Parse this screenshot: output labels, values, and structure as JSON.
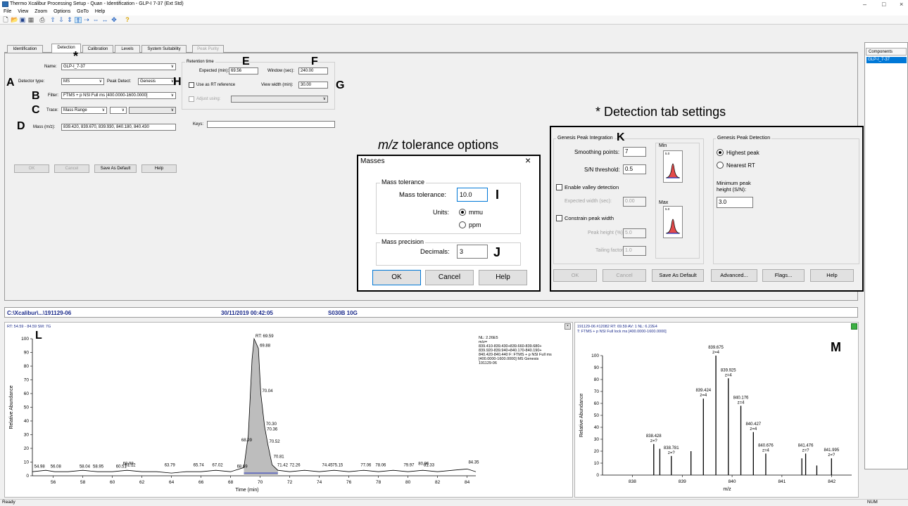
{
  "window": {
    "title": "Thermo Xcalibur Processing Setup - Quan - Identification - GLP-I 7-37 (Ext Std)",
    "controls": [
      "–",
      "□",
      "×"
    ]
  },
  "menu": [
    "File",
    "View",
    "Zoom",
    "Options",
    "GoTo",
    "Help"
  ],
  "tabs": [
    "Identification",
    "Detection",
    "Calibration",
    "Levels",
    "System Suitability",
    "Peak Purity"
  ],
  "identification": {
    "name_label": "Name:",
    "name_value": "GLP-I_7-37",
    "detector_type_label": "Detector type:",
    "detector_type_value": "MS",
    "peak_detect_label": "Peak Detect:",
    "peak_detect_value": "Genesis",
    "filter_label": "Filter:",
    "filter_value": "FTMS + p NSI Full ms [400.0000-1600.0000]",
    "trace_label": "Trace:",
    "trace_value": "Mass Range",
    "mass_label": "Mass (m/z):",
    "mass_value": "839.420, 839.670, 839.930, 840.180, 840.430",
    "retention_time_label": "Retention time",
    "expected_label": "Expected (min):",
    "expected_value": "69.56",
    "window_label": "Window (sec):",
    "window_value": "240.00",
    "use_rt_reference": "Use as RT reference",
    "view_width_label": "View width (min):",
    "view_width_value": "30.00",
    "adjust_using": "Adjust using:",
    "keys_label": "Keys:",
    "buttons": [
      "OK",
      "Cancel",
      "Save As Default",
      "Help"
    ]
  },
  "annotations": {
    "letters": [
      "A",
      "B",
      "C",
      "D",
      "E",
      "F",
      "G",
      "H",
      "I",
      "J",
      "K",
      "L",
      "M"
    ],
    "star": "*",
    "mz_tolerance_title_italic": "m/z",
    "mz_tolerance_title_rest": " tolerance options",
    "detection_title": "* Detection tab settings"
  },
  "masses_dialog": {
    "title": "Masses",
    "mass_tolerance_group": "Mass tolerance",
    "mass_tolerance_label": "Mass tolerance:",
    "mass_tolerance_value": "10.0",
    "units_label": "Units:",
    "unit_mmu": "mmu",
    "unit_ppm": "ppm",
    "mass_precision_group": "Mass precision",
    "decimals_label": "Decimals:",
    "decimals_value": "3",
    "ok": "OK",
    "cancel": "Cancel",
    "help": "Help"
  },
  "detection": {
    "integration_group": "Genesis Peak Integration",
    "smoothing_label": "Smoothing points:",
    "smoothing_value": "7",
    "sn_label": "S/N threshold:",
    "sn_value": "0.5",
    "valley_label": "Enable valley detection",
    "expected_width_label": "Expected width (sec):",
    "expected_width_value": "0.00",
    "constrain_label": "Constrain peak width",
    "peak_height_label": "Peak height (%):",
    "peak_height_value": "5.0",
    "tailing_label": "Tailing factor:",
    "tailing_value": "1.0",
    "min_label": "Min",
    "max_label": "Max",
    "thumb_value": "5.0",
    "detection_group": "Genesis Peak Detection",
    "highest_peak": "Highest peak",
    "nearest_rt": "Nearest RT",
    "min_height_label": "Minimum peak height (S/N):",
    "min_height_value": "3.0",
    "buttons": [
      "OK",
      "Cancel",
      "Save As Default",
      "Advanced...",
      "Flags...",
      "Help"
    ]
  },
  "components": {
    "header": "Components",
    "items": [
      "GLP-I_7-37"
    ]
  },
  "infobar": {
    "path": "C:\\Xcalibur\\...\\191129-06",
    "datetime": "30/11/2019 00:42:05",
    "sample": "S030B 10G"
  },
  "chromatogram": {
    "header": "RT: 54.59 - 84.59   SM: 7G",
    "ylabel": "Relative Abundance",
    "xlabel": "Time (min)",
    "info": [
      "NL: 2.26E5",
      "m/z=",
      "839.410-839.430+839.660-839.680+",
      "839.920-839.940+840.170-840.190+",
      "840.420-840.440 F: FTMS + p NSI Full ms",
      "[400.0000-1600.0000]  MS  Genesis",
      "191129-06"
    ],
    "apex_label": "RT: 69.59"
  },
  "spectrum": {
    "header1": "191129-06 #12082  RT: 69.59  AV: 1  NL: 6.22E4",
    "header2": "T: FTMS + p NSI Full lock ms [400.0000-1600.0000]",
    "ylabel": "Relative Abundance",
    "xlabel": "m/z"
  },
  "chart_data": [
    {
      "type": "area",
      "xlabel": "Time (min)",
      "ylabel": "Relative Abundance",
      "xlim": [
        54.59,
        84.59
      ],
      "ylim": [
        0,
        100
      ],
      "x_ticks": [
        56,
        58,
        60,
        62,
        64,
        66,
        68,
        70,
        72,
        74,
        76,
        78,
        80,
        82,
        84
      ],
      "y_ticks": [
        0,
        10,
        20,
        30,
        40,
        50,
        60,
        70,
        80,
        90,
        100
      ],
      "points": [
        [
          54.6,
          3
        ],
        [
          55.5,
          4
        ],
        [
          56.1,
          3
        ],
        [
          57.0,
          3
        ],
        [
          58.0,
          4
        ],
        [
          59.0,
          3
        ],
        [
          60.0,
          3
        ],
        [
          61.0,
          4
        ],
        [
          62.0,
          3
        ],
        [
          63.0,
          3
        ],
        [
          64.0,
          2
        ],
        [
          65.0,
          3
        ],
        [
          66.0,
          3
        ],
        [
          67.0,
          4
        ],
        [
          68.0,
          3
        ],
        [
          68.9,
          6
        ],
        [
          69.2,
          30
        ],
        [
          69.45,
          85
        ],
        [
          69.59,
          100
        ],
        [
          69.88,
          93
        ],
        [
          70.04,
          60
        ],
        [
          70.3,
          36
        ],
        [
          70.52,
          23
        ],
        [
          70.81,
          8
        ],
        [
          71.2,
          4
        ],
        [
          72.0,
          3
        ],
        [
          73.0,
          4
        ],
        [
          74.0,
          3
        ],
        [
          75.0,
          4
        ],
        [
          76.0,
          3
        ],
        [
          77.0,
          4
        ],
        [
          78.0,
          3
        ],
        [
          79.0,
          4
        ],
        [
          80.0,
          3
        ],
        [
          81.0,
          4
        ],
        [
          82.0,
          3
        ],
        [
          83.0,
          4
        ],
        [
          84.0,
          5
        ],
        [
          84.59,
          3
        ]
      ],
      "peak_labels": [
        {
          "x": 69.59,
          "y": 100,
          "text": "RT: 69.59"
        },
        {
          "x": 69.88,
          "y": 93,
          "text": "69.88"
        },
        {
          "x": 70.04,
          "y": 60,
          "text": "70.04"
        },
        {
          "x": 70.3,
          "y": 36,
          "text": "70.30"
        },
        {
          "x": 70.36,
          "y": 32,
          "text": "70.36"
        },
        {
          "x": 70.52,
          "y": 23,
          "text": "70.52"
        },
        {
          "x": 70.81,
          "y": 12,
          "text": "70.81"
        },
        {
          "x": 68.99,
          "y": 24,
          "text": "68.99"
        },
        {
          "x": 54.98,
          "y": 5,
          "text": "54.98"
        },
        {
          "x": 56.08,
          "y": 5,
          "text": "56.08"
        },
        {
          "x": 58.04,
          "y": 5,
          "text": "58.04"
        },
        {
          "x": 58.95,
          "y": 5,
          "text": "58.95"
        },
        {
          "x": 60.51,
          "y": 5,
          "text": "60.51"
        },
        {
          "x": 60.98,
          "y": 7,
          "text": "60.98"
        },
        {
          "x": 61.12,
          "y": 6,
          "text": "61.12"
        },
        {
          "x": 63.79,
          "y": 6,
          "text": "63.79"
        },
        {
          "x": 65.74,
          "y": 6,
          "text": "65.74"
        },
        {
          "x": 67.02,
          "y": 6,
          "text": "67.02"
        },
        {
          "x": 68.69,
          "y": 5,
          "text": "68.69"
        },
        {
          "x": 71.42,
          "y": 6,
          "text": "71.42"
        },
        {
          "x": 72.26,
          "y": 6,
          "text": "72.26"
        },
        {
          "x": 74.45,
          "y": 6,
          "text": "74.45"
        },
        {
          "x": 75.15,
          "y": 6,
          "text": "75.15"
        },
        {
          "x": 77.06,
          "y": 6,
          "text": "77.06"
        },
        {
          "x": 78.06,
          "y": 6,
          "text": "78.06"
        },
        {
          "x": 79.97,
          "y": 6,
          "text": "79.97"
        },
        {
          "x": 80.96,
          "y": 7,
          "text": "80.96"
        },
        {
          "x": 81.33,
          "y": 6,
          "text": "81.33"
        },
        {
          "x": 84.35,
          "y": 8,
          "text": "84.35"
        }
      ]
    },
    {
      "type": "bar",
      "xlabel": "m/z",
      "ylabel": "Relative Abundance",
      "xlim": [
        837.4,
        842.4
      ],
      "ylim": [
        0,
        100
      ],
      "x_ticks": [
        838,
        839,
        840,
        841,
        842
      ],
      "y_ticks": [
        0,
        10,
        20,
        30,
        40,
        50,
        60,
        70,
        80,
        90,
        100
      ],
      "peaks": [
        {
          "mz": 838.428,
          "y": 26,
          "label": "838.428",
          "z": "z=?"
        },
        {
          "mz": 838.55,
          "y": 22,
          "label": "",
          "z": ""
        },
        {
          "mz": 838.781,
          "y": 16,
          "label": "838.781",
          "z": "z=?"
        },
        {
          "mz": 839.175,
          "y": 20,
          "label": "",
          "z": ""
        },
        {
          "mz": 839.424,
          "y": 64,
          "label": "839.424",
          "z": "z=4"
        },
        {
          "mz": 839.675,
          "y": 100,
          "label": "839.675",
          "z": "z=4"
        },
        {
          "mz": 839.925,
          "y": 81,
          "label": "839.925",
          "z": "z=4"
        },
        {
          "mz": 840.176,
          "y": 58,
          "label": "840.176",
          "z": "z=4"
        },
        {
          "mz": 840.427,
          "y": 36,
          "label": "840.427",
          "z": "z=4"
        },
        {
          "mz": 840.676,
          "y": 18,
          "label": "840.676",
          "z": "z=4"
        },
        {
          "mz": 841.4,
          "y": 14,
          "label": "",
          "z": ""
        },
        {
          "mz": 841.476,
          "y": 18,
          "label": "841.476",
          "z": "z=?"
        },
        {
          "mz": 841.7,
          "y": 8,
          "label": "",
          "z": ""
        },
        {
          "mz": 841.995,
          "y": 14,
          "label": "841.995",
          "z": "z=?"
        }
      ]
    }
  ],
  "statusbar": {
    "left": "Ready",
    "right": "NUM"
  },
  "colors": {
    "selection": "#0078d7",
    "peak_fill": "#bdbdbd",
    "baseline": "#2030c0",
    "callout_border": "#000000"
  }
}
